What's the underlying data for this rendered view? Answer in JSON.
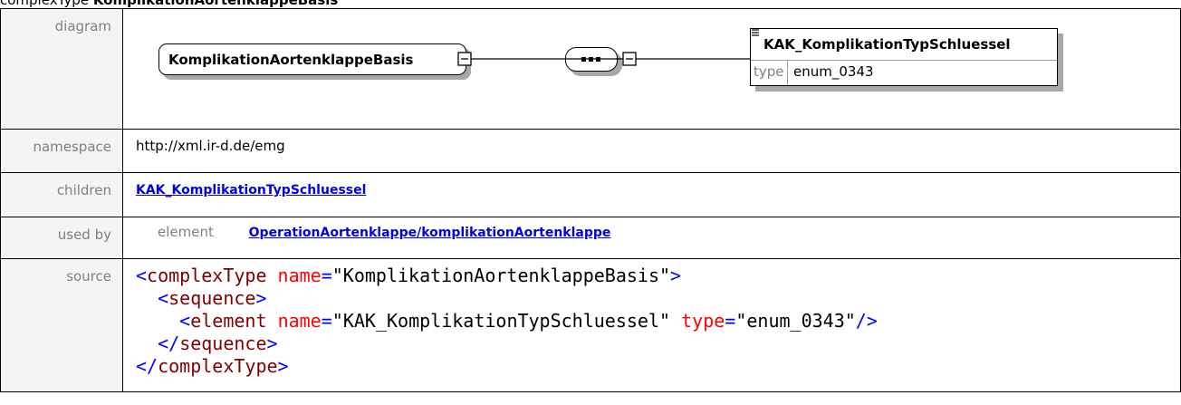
{
  "heading": {
    "prefix": "complexType",
    "name": "KomplikationAortenklappeBasis"
  },
  "rows": {
    "diagram_label": "diagram",
    "namespace_label": "namespace",
    "namespace_value": "http://xml.ir-d.de/emg",
    "children_label": "children",
    "children_value": "KAK_KomplikationTypSchluessel",
    "usedby_label": "used by",
    "usedby_kind": "element",
    "usedby_value": "OperationAortenklappe/komplikationAortenklappe",
    "source_label": "source"
  },
  "diagram": {
    "complex_type_name": "KomplikationAortenklappeBasis",
    "element_name": "KAK_KomplikationTypSchluessel",
    "type_label": "type",
    "type_value": "enum_0343"
  },
  "source": {
    "l1_tag": "complexType",
    "l1_attr": "name",
    "l1_val": "\"KomplikationAortenklappeBasis\"",
    "l2_tag": "sequence",
    "l3_tag": "element",
    "l3_attr1": "name",
    "l3_val1": "\"KAK_KomplikationTypSchluessel\"",
    "l3_attr2": "type",
    "l3_val2": "\"enum_0343\"",
    "l4_tag": "sequence",
    "l5_tag": "complexType"
  }
}
